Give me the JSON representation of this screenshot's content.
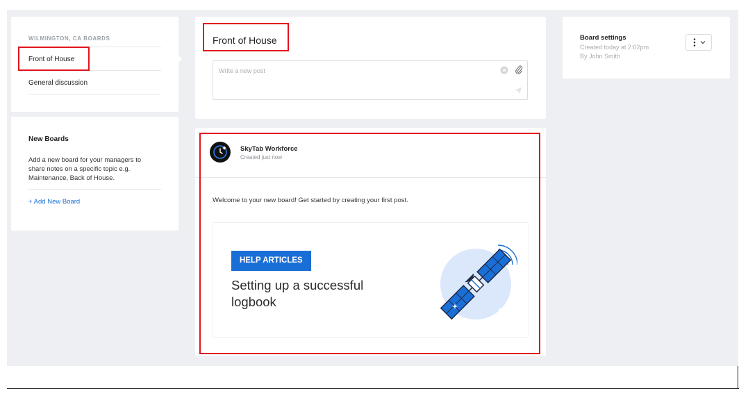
{
  "sidebar": {
    "heading": "WILMINGTON, CA BOARDS",
    "boards": [
      {
        "label": "Front of House"
      },
      {
        "label": "General discussion"
      }
    ]
  },
  "new_boards": {
    "title": "New Boards",
    "description": "Add a new board for your managers to share notes on a specific topic e.g. Maintenance, Back of House.",
    "add_label": "+  Add New Board"
  },
  "main": {
    "board_title": "Front of House",
    "post": {
      "placeholder": "Write a new post",
      "value": ""
    }
  },
  "feed": {
    "post": {
      "author": "SkyTab Workforce",
      "meta": "Created just now",
      "body": "Welcome to your new board! Get started by creating your first post.",
      "banner": {
        "badge": "HELP ARTICLES",
        "title": "Setting up a successful logbook"
      }
    }
  },
  "settings": {
    "title": "Board settings",
    "created": "Created today at 2:02pm",
    "author": "By John Smith"
  },
  "colors": {
    "accent": "#1a6fd6",
    "highlight": "#e1141e",
    "background": "#eeeff2"
  },
  "icons": [
    "clear-icon",
    "attachment-icon",
    "send-icon",
    "clock-icon",
    "more-vertical-icon",
    "chevron-down-icon",
    "satellite-icon"
  ]
}
